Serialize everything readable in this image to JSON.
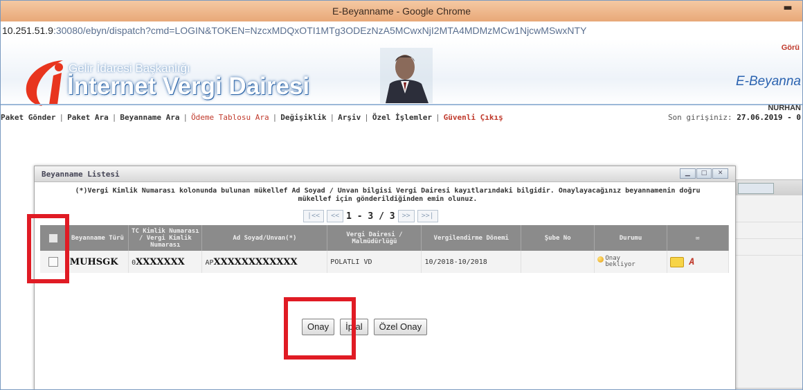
{
  "browser": {
    "title": "E-Beyanname - Google Chrome",
    "minimize_icon": "minus-icon",
    "url_host": "10.251.51.9",
    "url_rest": ":30080/ebyn/dispatch?cmd=LOGIN&TOKEN=NzcxMDQxOTI1MTg3ODEzNzA5MCwxNjI2MTA4MDMzMCw1NjcwMSwxNTY"
  },
  "header": {
    "corner_link": "Görü",
    "org_name": "Gelir İdaresi Başkanlığı",
    "site_name": "İnternet Vergi Dairesi",
    "app_name": "E-Beyanna",
    "username": "NURHAN",
    "logo_icon": "gib-logo-icon",
    "portrait_icon": "ataturk-portrait-icon"
  },
  "menu": {
    "items": [
      {
        "label": "Paket Gönder",
        "style": "normal"
      },
      {
        "label": "Paket Ara",
        "style": "normal"
      },
      {
        "label": "Beyanname Ara",
        "style": "normal"
      },
      {
        "label": "Ödeme Tablosu Ara",
        "style": "pink"
      },
      {
        "label": "Değişiklik",
        "style": "normal"
      },
      {
        "label": "Arşiv",
        "style": "normal"
      },
      {
        "label": "Özel İşlemler",
        "style": "normal"
      },
      {
        "label": "Güvenli Çıkış",
        "style": "red"
      }
    ],
    "last_login_label": "Son girişiniz:",
    "last_login_value": "27.06.2019 - 0"
  },
  "dialog": {
    "title": "Beyanname Listesi",
    "notice": "(*)Vergi Kimlik Numarası kolonunda bulunan mükellef Ad Soyad / Unvan bilgisi Vergi Dairesi kayıtlarındaki bilgidir. Onaylayacağınız beyannamenin doğru mükellef için gönderildiğinden emin olunuz.",
    "pager": {
      "first": "|<<",
      "prev": "<<",
      "info": "1 - 3 / 3",
      "next": ">>",
      "last": ">>|"
    },
    "columns": [
      "",
      "Beyanname Türü",
      "TC Kimlik Numarası / Vergi Kimlik Numarası",
      "Ad Soyad/Unvan(*)",
      "Vergi Dairesi / Malmüdürlüğü",
      "Vergilendirme Dönemi",
      "Şube No",
      "Durumu",
      "✉"
    ],
    "rows": [
      {
        "type": "MUHSGK",
        "tckn_prefix": "0",
        "tckn": "XXXXXXX",
        "name_prefix": "AP",
        "name": "XXXXXXXXXXXX",
        "office": "POLATLI VD",
        "period": "10/2018-10/2018",
        "branch": "",
        "status": "Onay bekliyor"
      }
    ],
    "buttons": {
      "approve": "Onay",
      "cancel": "İptal",
      "special_approve": "Özel Onay"
    }
  },
  "colors": {
    "highlight_box": "#e01b24",
    "header_row": "#8b8b8b",
    "brand_blue": "#2b63b0"
  }
}
